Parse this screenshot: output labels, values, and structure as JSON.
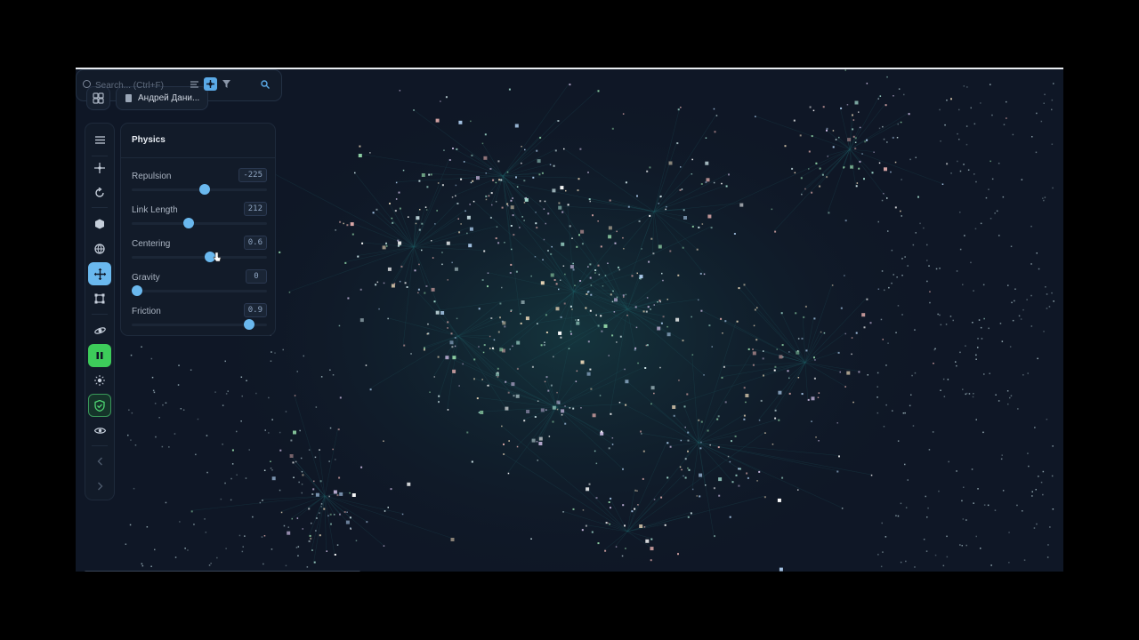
{
  "header": {
    "workspace_name": "Андрей Дани...",
    "search_placeholder": "Search... (Ctrl+F)"
  },
  "physics": {
    "title": "Physics",
    "params": [
      {
        "label": "Repulsion",
        "value": "-225",
        "fraction": 0.54
      },
      {
        "label": "Link Length",
        "value": "212",
        "fraction": 0.42
      },
      {
        "label": "Centering",
        "value": "0.6",
        "fraction": 0.58
      },
      {
        "label": "Gravity",
        "value": "0",
        "fraction": 0.04
      },
      {
        "label": "Friction",
        "value": "0.9",
        "fraction": 0.87
      }
    ]
  },
  "icons": {
    "layout": "grid-layout-icon",
    "workspace": "document-icon",
    "search": "search-icon",
    "toolbar": [
      "menu-icon",
      "crosshair-icon",
      "refresh-icon",
      "cube-icon",
      "globe-icon",
      "move-icon",
      "select-box-icon",
      "orbit-icon",
      "pause-icon",
      "sun-icon",
      "shield-check-icon",
      "eye-icon",
      "chevron-left-icon",
      "chevron-right-icon"
    ]
  },
  "colors": {
    "background": "#0f1726",
    "accent": "#6ab8ee",
    "play_active": "#3dcc5a"
  }
}
